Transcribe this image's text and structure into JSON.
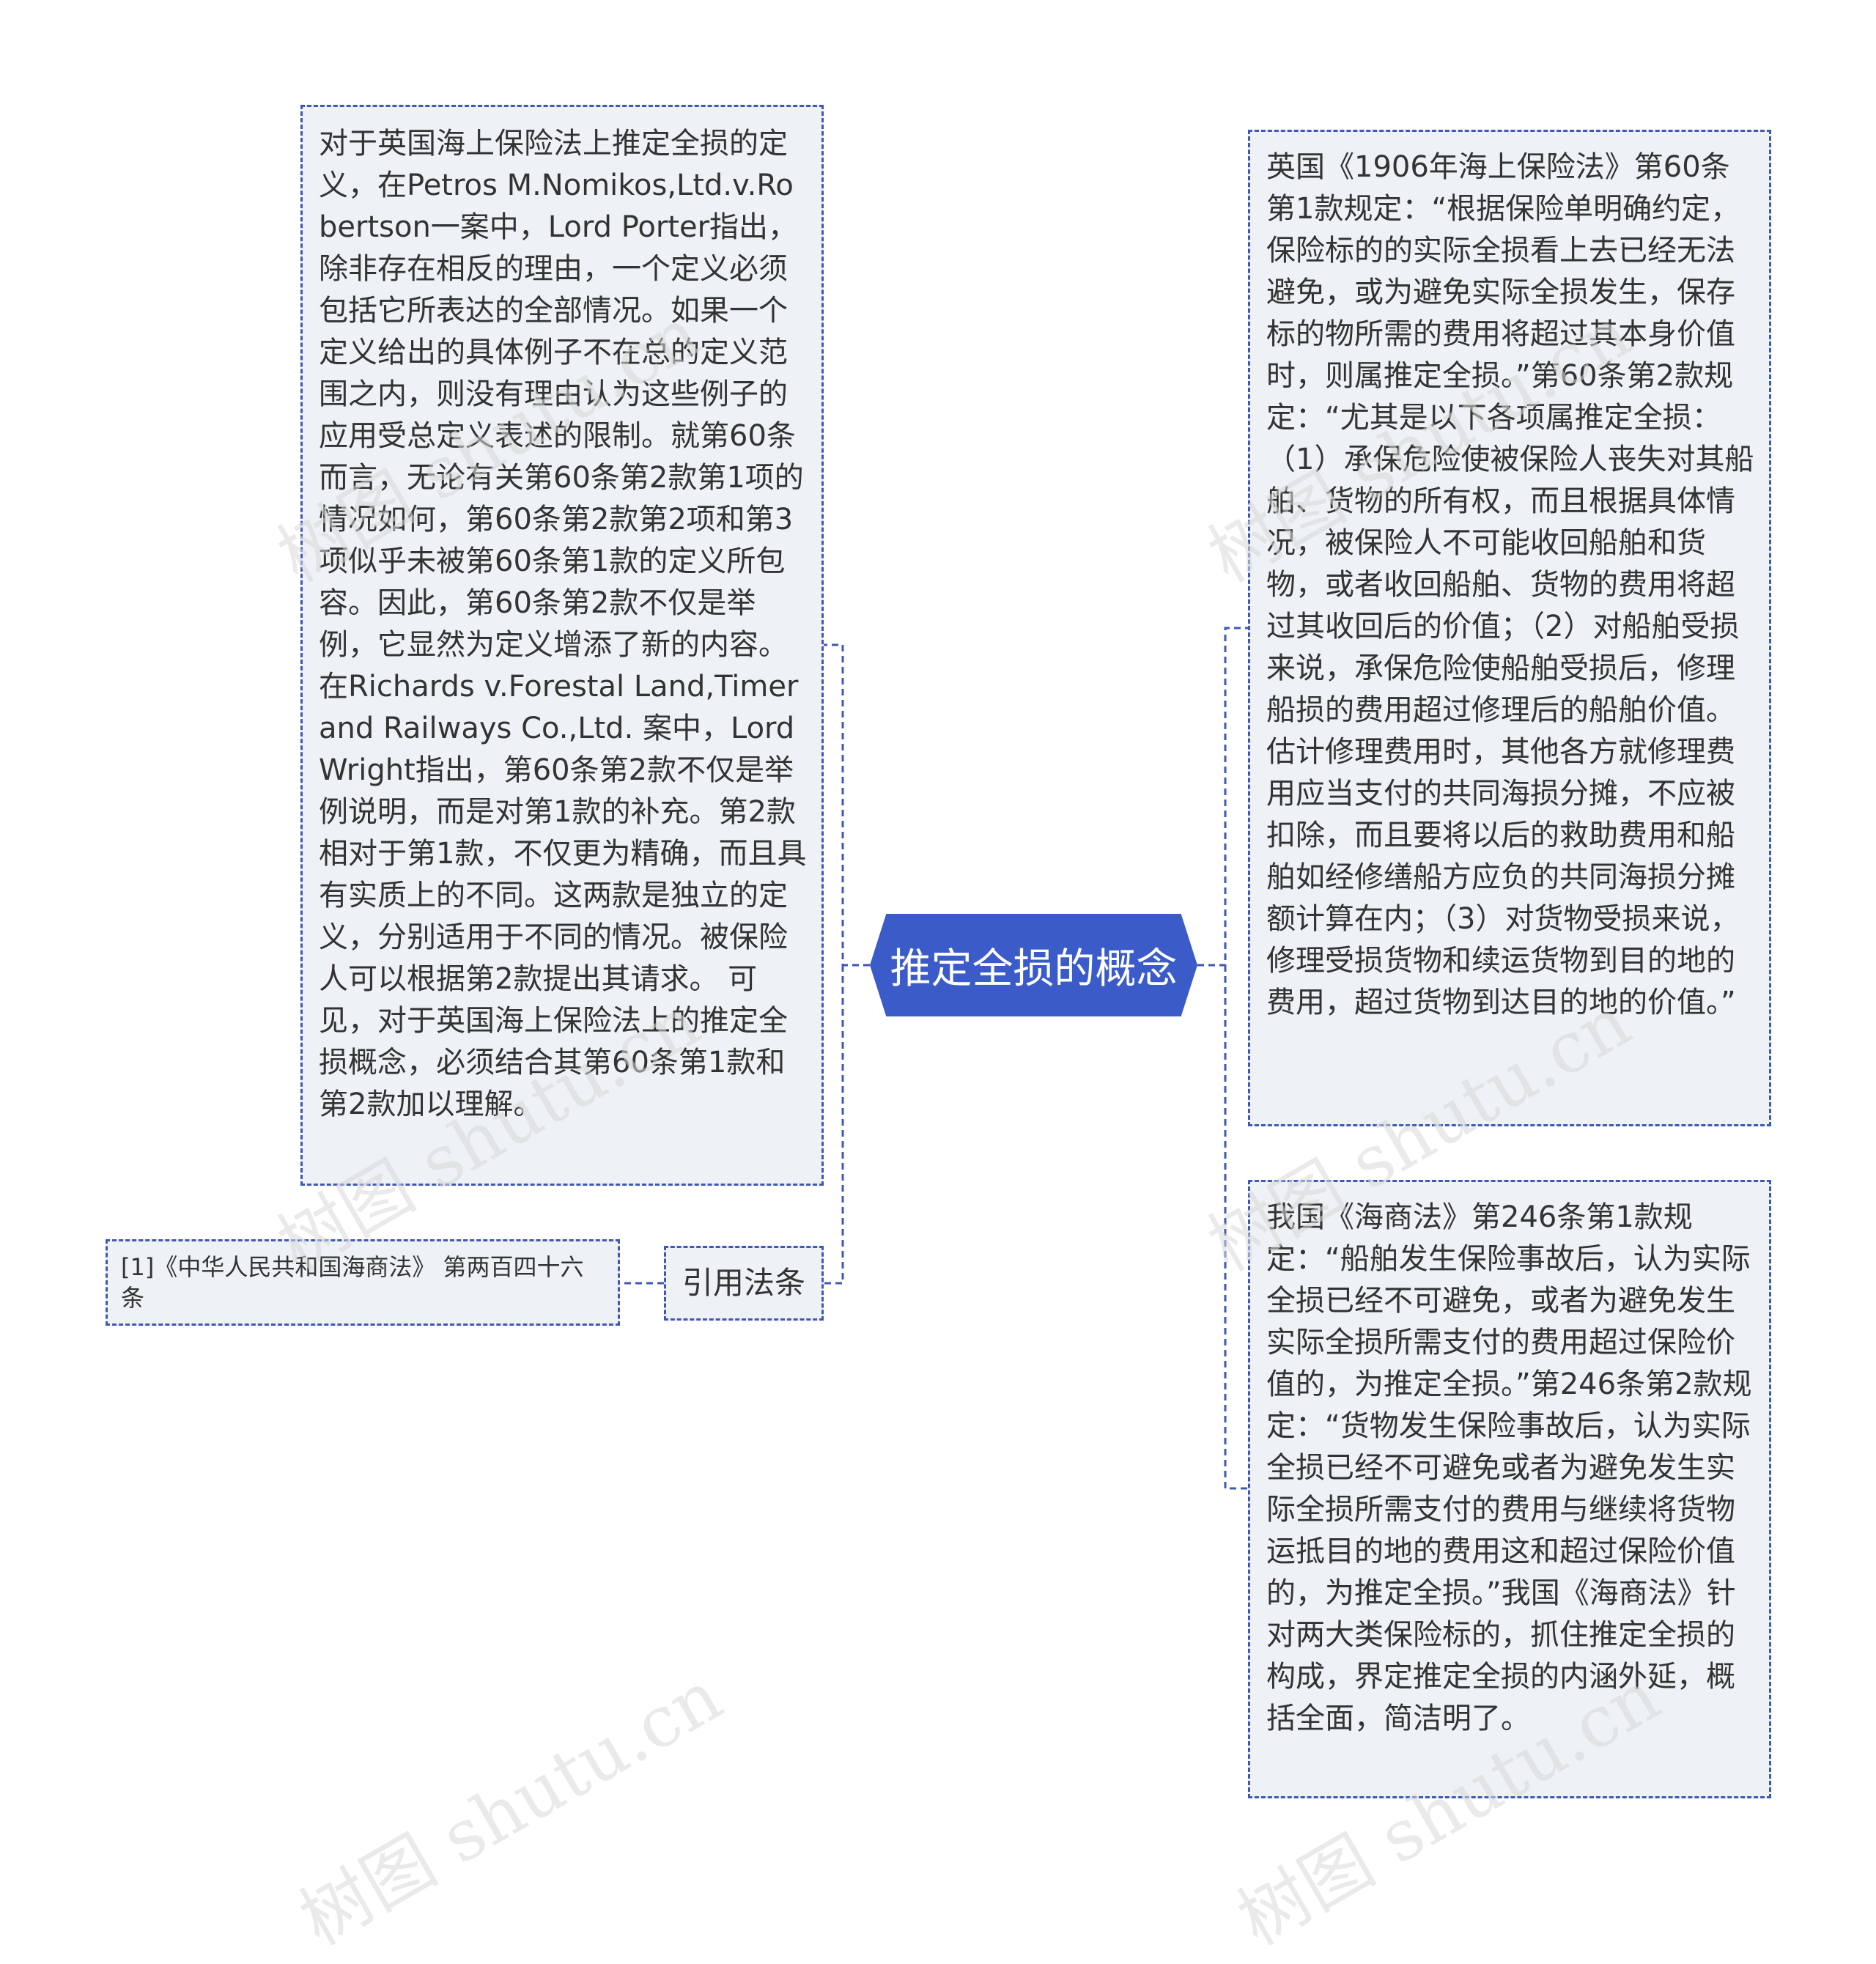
{
  "mindmap": {
    "root": {
      "label": "推定全损的概念"
    },
    "left_node": {
      "text": "对于英国海上保险法上推定全损的定义，在Petros M.Nomikos,Ltd.v.Robertson一案中，Lord Porter指出，除非存在相反的理由，一个定义必须包括它所表达的全部情况。如果一个定义给出的具体例子不在总的定义范围之内，则没有理由认为这些例子的应用受总定义表述的限制。就第60条而言，无论有关第60条第2款第1项的情况如何，第60条第2款第2项和第3项似乎未被第60条第1款的定义所包容。因此，第60条第2款不仅是举例，它显然为定义增添了新的内容。在Richards v.Forestal Land,Timer and Railways Co.,Ltd. 案中，Lord Wright指出，第60条第2款不仅是举例说明，而是对第1款的补充。第2款相对于第1款，不仅更为精确，而且具有实质上的不同。这两款是独立的定义，分别适用于不同的情况。被保险人可以根据第2款提出其请求。 可见，对于英国海上保险法上的推定全损概念，必须结合其第60条第1款和第2款加以理解。"
    },
    "cite_node": {
      "label": "引用法条"
    },
    "ref_node": {
      "text": "[1]《中华人民共和国海商法》 第两百四十六条"
    },
    "right_nodes": [
      {
        "text": "英国《1906年海上保险法》第60条第1款规定：“根据保险单明确约定，保险标的的实际全损看上去已经无法避免，或为避免实际全损发生，保存标的物所需的费用将超过其本身价值时，则属推定全损。”第60条第2款规定：“尤其是以下各项属推定全损：（1）承保危险使被保险人丧失对其船舶、货物的所有权，而且根据具体情况，被保险人不可能收回船舶和货物，或者收回船舶、货物的费用将超过其收回后的价值；（2）对船舶受损来说，承保危险使船舶受损后，修理船损的费用超过修理后的船舶价值。估计修理费用时，其他各方就修理费用应当支付的共同海损分摊，不应被扣除，而且要将以后的救助费用和船舶如经修缮船方应负的共同海损分摊额计算在内；（3）对货物受损来说，修理受损货物和续运货物到目的地的费用，超过货物到达目的地的价值。”"
      },
      {
        "text": "我国《海商法》第246条第1款规定：“船舶发生保险事故后，认为实际全损已经不可避免，或者为避免发生实际全损所需支付的费用超过保险价值的，为推定全损。”第246条第2款规定：“货物发生保险事故后，认为实际全损已经不可避免或者为避免发生实际全损所需支付的费用与继续将货物运抵目的地的费用这和超过保险价值的，为推定全损。”我国《海商法》针对两大类保险标的，抓住推定全损的构成，界定推定全损的内涵外延，概括全面，简洁明了。"
      }
    ]
  },
  "watermark": {
    "text": "树图 shutu.cn"
  },
  "colors": {
    "root_fill": "#3b5bc9",
    "node_fill": "#eef1f5",
    "link": "#3f57b8",
    "text": "#333333"
  }
}
